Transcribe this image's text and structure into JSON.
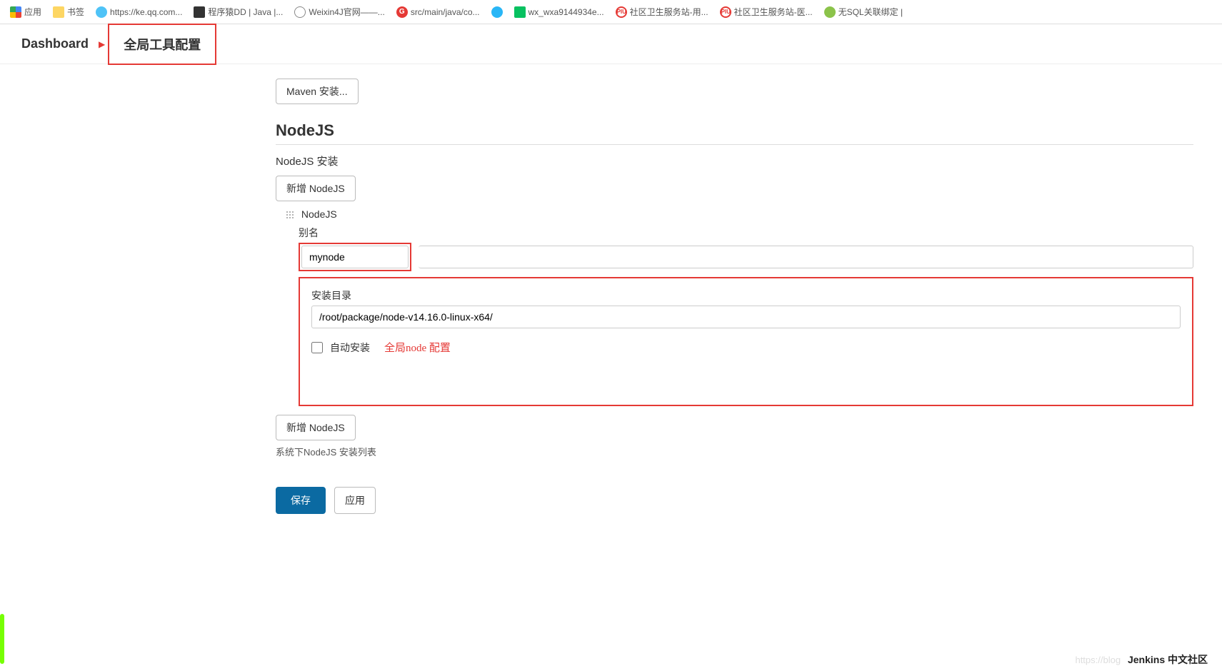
{
  "bookmarks": {
    "apps": "应用",
    "folder": "书签",
    "keqq": "https://ke.qq.com...",
    "dd": "程序猿DD | Java |...",
    "weixin4j": "Weixin4J官网——...",
    "srcmain": "src/main/java/co...",
    "wx": "wx_wxa9144934e...",
    "hs1": "社区卫生服务站-用...",
    "hs2": "社区卫生服务站-医...",
    "nosql": "无SQL关联绑定 |"
  },
  "breadcrumb": {
    "dashboard": "Dashboard",
    "gtc": "全局工具配置"
  },
  "maven": {
    "installBtn": "Maven 安装..."
  },
  "nodejs": {
    "title": "NodeJS",
    "installLabel": "NodeJS 安装",
    "addBtn": "新增 NodeJS",
    "blockTitle": "NodeJS",
    "aliasLabel": "别名",
    "aliasValue": "mynode",
    "installDirLabel": "安装目录",
    "installDirValue": "/root/package/node-v14.16.0-linux-x64/",
    "autoInstallLabel": "自动安装",
    "annotation": "全局node 配置",
    "addBtn2": "新增 NodeJS",
    "listHelp": "系统下NodeJS 安装列表"
  },
  "actions": {
    "save": "保存",
    "apply": "应用"
  },
  "footer": {
    "watermark": "https://blog",
    "jenkins": "Jenkins 中文社区"
  }
}
